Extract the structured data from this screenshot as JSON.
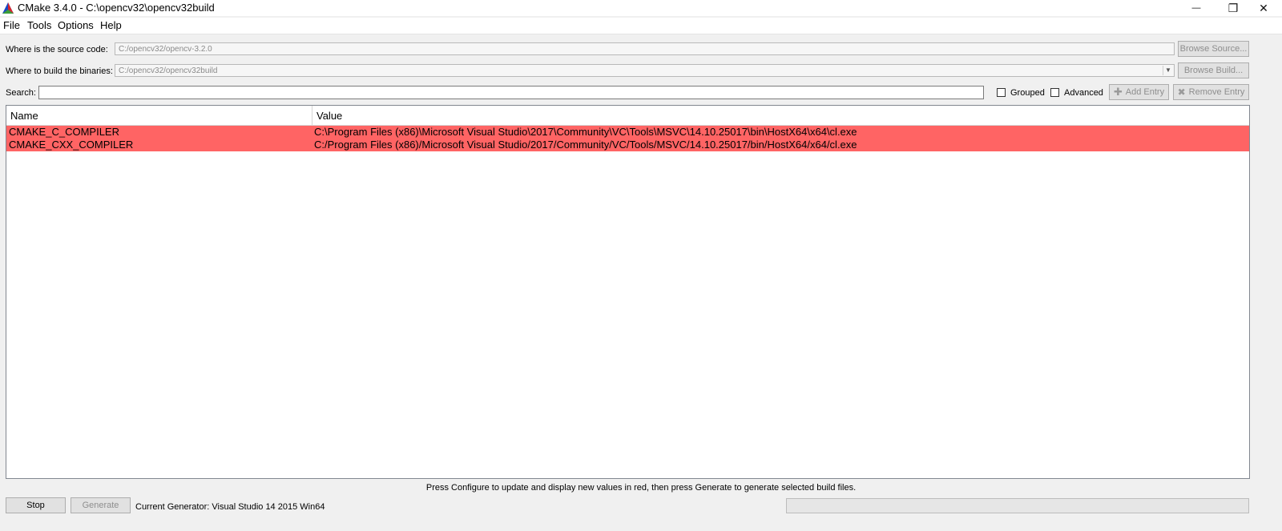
{
  "window": {
    "title": "CMake 3.4.0 - C:\\opencv32\\opencv32build",
    "minimize_glyph": "—",
    "restore_glyph": "❐",
    "close_glyph": "✕"
  },
  "menu": [
    "File",
    "Tools",
    "Options",
    "Help"
  ],
  "source": {
    "label": "Where is the source code:",
    "value": "C:/opencv32/opencv-3.2.0",
    "button": "Browse Source..."
  },
  "build": {
    "label": "Where to build the binaries:",
    "value": "C:/opencv32/opencv32build",
    "button": "Browse Build..."
  },
  "search": {
    "label": "Search:",
    "value": "",
    "grouped_label": "Grouped",
    "grouped_checked": false,
    "advanced_label": "Advanced",
    "advanced_checked": false,
    "add_entry": "Add Entry",
    "remove_entry": "Remove Entry"
  },
  "table": {
    "columns": [
      "Name",
      "Value"
    ],
    "rows": [
      {
        "name": "CMAKE_C_COMPILER",
        "value": "C:\\Program Files (x86)\\Microsoft Visual Studio\\2017\\Community\\VC\\Tools\\MSVC\\14.10.25017\\bin\\HostX64\\x64\\cl.exe"
      },
      {
        "name": "CMAKE_CXX_COMPILER",
        "value": "C:/Program Files (x86)/Microsoft Visual Studio/2017/Community/VC/Tools/MSVC/14.10.25017/bin/HostX64/x64/cl.exe"
      }
    ],
    "new_row_color": "#ff6464"
  },
  "footer": {
    "hint": "Press Configure to update and display new values in red, then press Generate to generate selected build files.",
    "stop_button": "Stop",
    "generate_button": "Generate",
    "generator_label": "Current Generator: Visual Studio 14 2015 Win64"
  }
}
